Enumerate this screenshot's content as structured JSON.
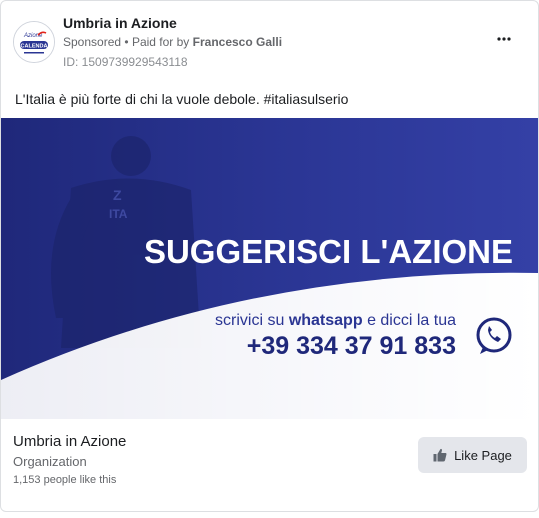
{
  "post": {
    "page_name": "Umbria in Azione",
    "sponsored": "Sponsored",
    "bullet": "•",
    "paid_for_by": "Paid for by",
    "payer": "Francesco Galli",
    "ad_id": "ID: 1509739929543118",
    "caption": "L'Italia è più forte di chi la vuole debole. #italiasulserio",
    "more_icon": "more-horizontal-icon",
    "avatar": {
      "logo_top": "Azione",
      "logo_mid": "CALENDA"
    }
  },
  "creative": {
    "headline": "SUGGERISCI L'AZIONE",
    "line1_pre": "scrivici su",
    "line1_brand": "whatsapp",
    "line1_post": "e dicci la tua",
    "phone": "+39 334 37 91 833",
    "jersey": "ITA",
    "icon": "whatsapp-icon",
    "colors": {
      "blue": "#2a3593",
      "dark_blue": "#1f287a",
      "white": "#ffffff"
    }
  },
  "footer": {
    "page_name": "Umbria in Azione",
    "category": "Organization",
    "likes": "1,153 people like this",
    "like_button": "Like Page",
    "like_icon": "thumbs-up-icon"
  }
}
